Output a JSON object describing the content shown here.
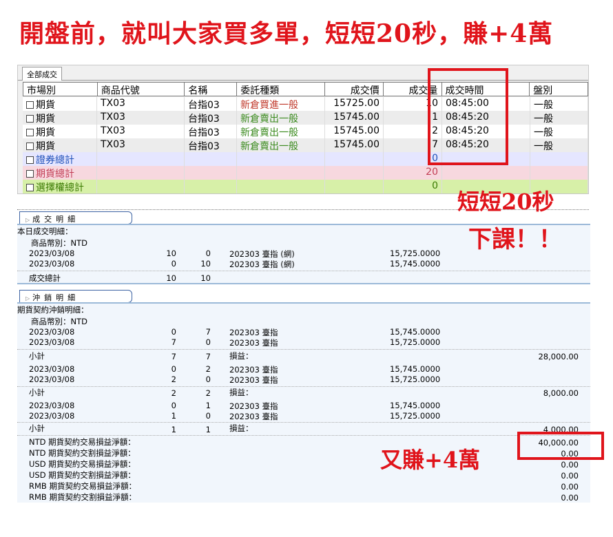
{
  "headline": "開盤前，就叫大家買多單，短短20秒，賺+4萬",
  "tab": "全部成交",
  "columns": [
    "市場別",
    "商品代號",
    "名稱",
    "委託種類",
    "成交價",
    "成交量",
    "成交時間",
    "盤別"
  ],
  "trades": [
    {
      "market": "期貨",
      "code": "TX03",
      "name": "台指03",
      "type": "新倉買進一般",
      "price": "15725.00",
      "qty": "10",
      "time": "08:45:00",
      "session": "一般"
    },
    {
      "market": "期貨",
      "code": "TX03",
      "name": "台指03",
      "type": "新倉賣出一般",
      "price": "15745.00",
      "qty": "1",
      "time": "08:45:20",
      "session": "一般"
    },
    {
      "market": "期貨",
      "code": "TX03",
      "name": "台指03",
      "type": "新倉賣出一般",
      "price": "15745.00",
      "qty": "2",
      "time": "08:45:20",
      "session": "一般"
    },
    {
      "market": "期貨",
      "code": "TX03",
      "name": "台指03",
      "type": "新倉賣出一般",
      "price": "15745.00",
      "qty": "7",
      "time": "08:45:20",
      "session": "一般"
    }
  ],
  "totals": {
    "securities": {
      "label": "證券總計",
      "qty": "0"
    },
    "futures": {
      "label": "期貨總計",
      "qty": "20"
    },
    "options": {
      "label": "選擇權總計",
      "qty": "0"
    }
  },
  "deal_detail": {
    "tab": "成交明細",
    "heading": "本日成交明細：",
    "currency": "商品幣別：NTD",
    "rows": [
      {
        "date": "2023/03/08",
        "buy": "10",
        "sell": "0",
        "product": "202303 臺指 (網)",
        "price": "15,725.0000"
      },
      {
        "date": "2023/03/08",
        "buy": "0",
        "sell": "10",
        "product": "202303 臺指 (網)",
        "price": "15,745.0000"
      }
    ],
    "total_label": "成交總計",
    "total_buy": "10",
    "total_sell": "10"
  },
  "offset_detail": {
    "tab": "沖銷明細",
    "heading": "期貨契約沖銷明細：",
    "currency": "商品幣別：NTD",
    "groups": [
      {
        "rows": [
          {
            "date": "2023/03/08",
            "buy": "0",
            "sell": "7",
            "product": "202303 臺指",
            "price": "15,745.0000"
          },
          {
            "date": "2023/03/08",
            "buy": "7",
            "sell": "0",
            "product": "202303 臺指",
            "price": "15,725.0000"
          }
        ],
        "sub_buy": "7",
        "sub_sell": "7",
        "pnl": "28,000.00"
      },
      {
        "rows": [
          {
            "date": "2023/03/08",
            "buy": "0",
            "sell": "2",
            "product": "202303 臺指",
            "price": "15,745.0000"
          },
          {
            "date": "2023/03/08",
            "buy": "2",
            "sell": "0",
            "product": "202303 臺指",
            "price": "15,725.0000"
          }
        ],
        "sub_buy": "2",
        "sub_sell": "2",
        "pnl": "8,000.00"
      },
      {
        "rows": [
          {
            "date": "2023/03/08",
            "buy": "0",
            "sell": "1",
            "product": "202303 臺指",
            "price": "15,745.0000"
          },
          {
            "date": "2023/03/08",
            "buy": "1",
            "sell": "0",
            "product": "202303 臺指",
            "price": "15,725.0000"
          }
        ],
        "sub_buy": "1",
        "sub_sell": "1",
        "pnl": "4,000.00"
      }
    ],
    "subtotal_label": "小計",
    "pnl_label": "損益：",
    "net": [
      {
        "label": "NTD 期貨契約交易損益淨額：",
        "value": "40,000.00"
      },
      {
        "label": "NTD 期貨契約交割損益淨額：",
        "value": "0.00"
      },
      {
        "label": "USD 期貨契約交易損益淨額：",
        "value": "0.00"
      },
      {
        "label": "USD 期貨契約交割損益淨額：",
        "value": "0.00"
      },
      {
        "label": "RMB 期貨契約交易損益淨額：",
        "value": "0.00"
      },
      {
        "label": "RMB 期貨契約交割損益淨額：",
        "value": "0.00"
      }
    ]
  },
  "notes": {
    "twenty_sec": "短短20秒",
    "class_over": "下課！！",
    "again": "又賺+4萬"
  },
  "colors": {
    "annotation": "#e0141b",
    "section_border": "#3d63a3"
  }
}
